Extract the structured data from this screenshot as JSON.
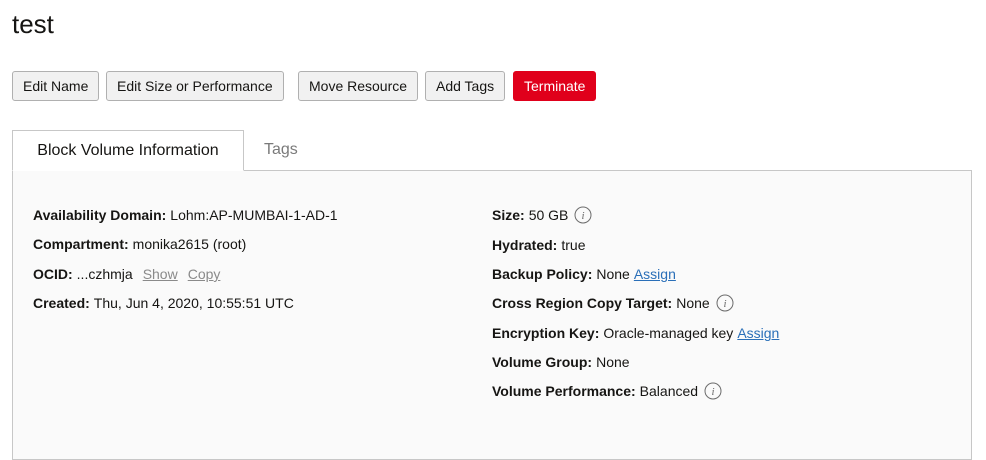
{
  "page": {
    "title": "test"
  },
  "toolbar": {
    "edit_name": "Edit Name",
    "edit_size": "Edit Size or Performance",
    "move_resource": "Move Resource",
    "add_tags": "Add Tags",
    "terminate": "Terminate"
  },
  "tabs": {
    "info": "Block Volume Information",
    "tags": "Tags"
  },
  "details_left": {
    "availability_domain": {
      "label": "Availability Domain:",
      "value": "Lohm:AP-MUMBAI-1-AD-1"
    },
    "compartment": {
      "label": "Compartment:",
      "value": "monika2615 (root)"
    },
    "ocid": {
      "label": "OCID:",
      "value": "...czhmja",
      "show": "Show",
      "copy": "Copy"
    },
    "created": {
      "label": "Created:",
      "value": "Thu, Jun 4, 2020, 10:55:51 UTC"
    }
  },
  "details_right": {
    "size": {
      "label": "Size:",
      "value": "50 GB",
      "icon": "info-icon"
    },
    "hydrated": {
      "label": "Hydrated:",
      "value": "true"
    },
    "backup_policy": {
      "label": "Backup Policy:",
      "value": "None",
      "link": "Assign"
    },
    "cross_region": {
      "label": "Cross Region Copy Target:",
      "value": "None",
      "icon": "info-icon"
    },
    "encryption_key": {
      "label": "Encryption Key:",
      "value": "Oracle-managed key",
      "link": "Assign"
    },
    "volume_group": {
      "label": "Volume Group:",
      "value": "None"
    },
    "volume_performance": {
      "label": "Volume Performance:",
      "value": "Balanced",
      "icon": "info-icon"
    }
  },
  "colors": {
    "danger": "#e0001b",
    "link": "#2a6fb8",
    "muted_link": "#8a8a8a",
    "panel_bg": "#fafafa",
    "border": "#c7c7c7"
  }
}
